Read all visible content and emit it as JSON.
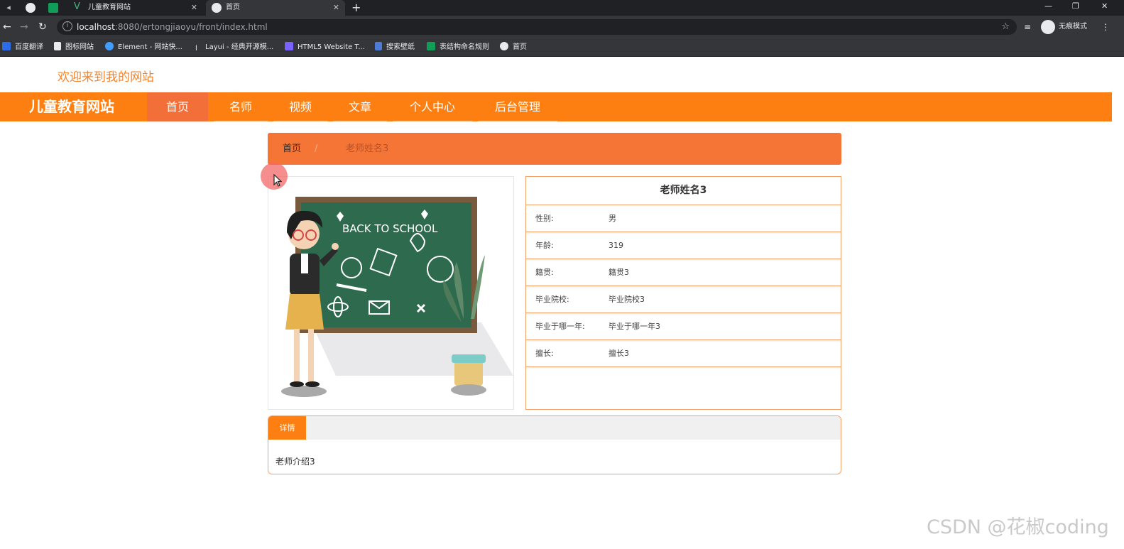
{
  "browser": {
    "tabs": [
      {
        "title": ""
      },
      {
        "title": ""
      },
      {
        "title": "儿童教育网站"
      },
      {
        "title": "首页"
      }
    ],
    "url_host": "localhost",
    "url_rest": ":8080/ertongjiaoyu/front/index.html",
    "incognito_label": "无痕模式",
    "bookmarks": [
      "百度翻译",
      "图标网站",
      "Element - 网站快...",
      "Layui - 经典开源模...",
      "HTML5 Website T...",
      "搜索壁纸",
      "表结构命名规则",
      "首页"
    ]
  },
  "page": {
    "welcome": "欢迎来到我的网站",
    "brand": "儿童教育网站",
    "nav": [
      "首页",
      "名师",
      "视频",
      "文章",
      "个人中心",
      "后台管理"
    ],
    "breadcrumb": {
      "home": "首页",
      "separator": "/",
      "current": "老师姓名3"
    },
    "teacher": {
      "name": "老师姓名3",
      "fields": [
        {
          "label": "性别:",
          "value": "男"
        },
        {
          "label": "年龄:",
          "value": "319"
        },
        {
          "label": "籍贯:",
          "value": "籍贯3"
        },
        {
          "label": "毕业院校:",
          "value": "毕业院校3"
        },
        {
          "label": "毕业于哪一年:",
          "value": "毕业于哪一年3"
        },
        {
          "label": "擅长:",
          "value": "擅长3"
        }
      ],
      "image_text": "BACK TO SCHOOL"
    },
    "detail": {
      "tab": "详情",
      "content": "老师介绍3"
    },
    "watermark": "CSDN @花椒coding"
  },
  "colors": {
    "orange": "#fd7f11",
    "breadcrumb": "#f47536",
    "border": "#f5a26a"
  }
}
